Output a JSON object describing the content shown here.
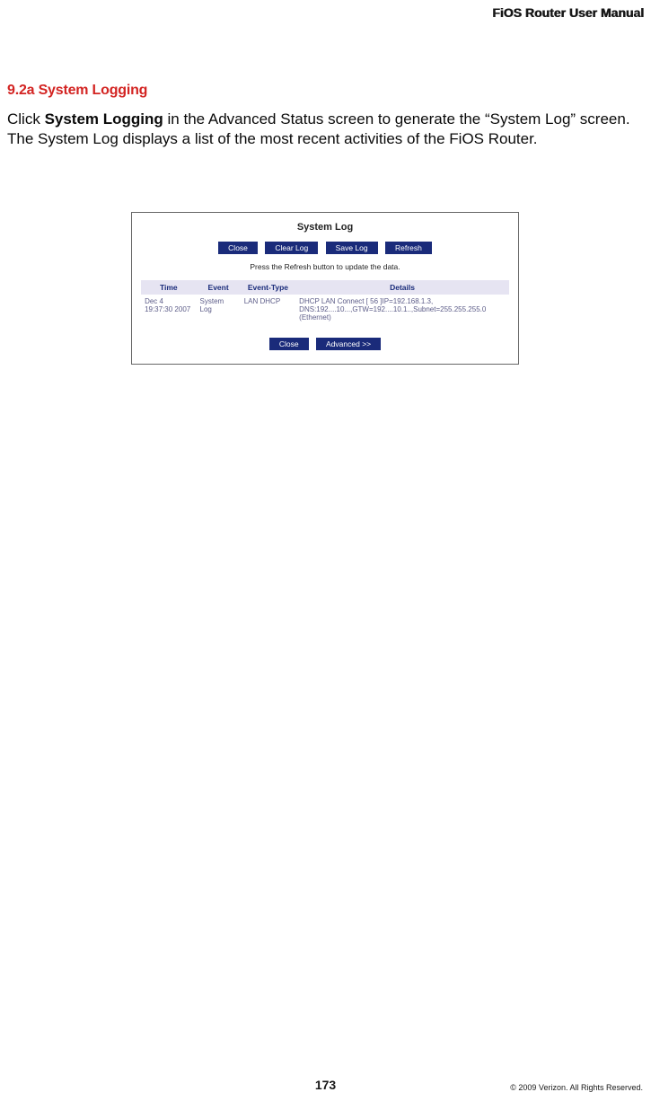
{
  "header": {
    "title": "FiOS Router User Manual"
  },
  "section": {
    "heading": "9.2a  System Logging"
  },
  "body": {
    "pre": "Click ",
    "bold": "System Logging",
    "post": " in the Advanced Status screen to generate the “System Log” screen. The System Log displays a list of the most recent activities of the FiOS Router."
  },
  "screenshot": {
    "title": "System Log",
    "buttons_top": {
      "close": "Close",
      "clear_log": "Clear Log",
      "save_log": "Save Log",
      "refresh": "Refresh"
    },
    "instruction": "Press the Refresh button to update the data.",
    "table": {
      "headers": {
        "time": "Time",
        "event": "Event",
        "event_type": "Event-Type",
        "details": "Details"
      },
      "row": {
        "time": "Dec  4 19:37:30 2007",
        "event": "System Log",
        "event_type": "LAN DHCP",
        "details": "DHCP LAN Connect [ 56 ]IP=192.168.1.3, DNS:192....10...,GTW=192....10.1..,Subnet=255.255.255.0 (Ethernet)"
      }
    },
    "buttons_bottom": {
      "close": "Close",
      "advanced": "Advanced >>"
    }
  },
  "footer": {
    "page_number": "173",
    "copyright": "© 2009 Verizon. All Rights Reserved."
  }
}
